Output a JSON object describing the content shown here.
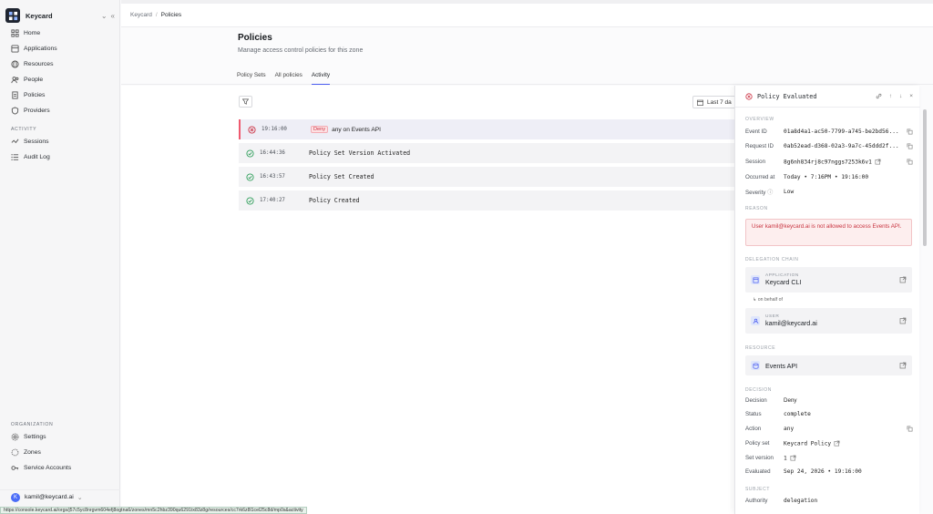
{
  "sidebar": {
    "brand": "Keycard",
    "nav": [
      {
        "label": "Home",
        "icon": "grid-icon"
      },
      {
        "label": "Applications",
        "icon": "apps-icon"
      },
      {
        "label": "Resources",
        "icon": "globe-icon"
      },
      {
        "label": "People",
        "icon": "people-icon"
      },
      {
        "label": "Policies",
        "icon": "document-icon"
      },
      {
        "label": "Providers",
        "icon": "shield-icon"
      }
    ],
    "activity_label": "ACTIVITY",
    "activity": [
      {
        "label": "Sessions",
        "icon": "sessions-icon"
      },
      {
        "label": "Audit Log",
        "icon": "list-icon"
      }
    ],
    "org_label": "ORGANIZATION",
    "org": [
      {
        "label": "Settings",
        "icon": "gear-icon"
      },
      {
        "label": "Zones",
        "icon": "zone-icon"
      },
      {
        "label": "Service Accounts",
        "icon": "key-icon"
      }
    ],
    "user": {
      "initial": "K",
      "email": "kamil@keycard.ai"
    }
  },
  "status_url": "https://console.keycard.ai/orgs/j57c5yc8nrgvm604efj8ogtna6/zones/mn5c2hbz390qu6291tx83z8g/resources/cc7rk6z8l1cel25c8d/mp0s&activity",
  "breadcrumb": [
    "Keycard",
    "Policies"
  ],
  "page": {
    "title": "Policies",
    "subtitle": "Manage access control policies for this zone",
    "tabs": [
      "Policy Sets",
      "All policies",
      "Activity"
    ],
    "active_tab": "Activity"
  },
  "filter": {
    "date_label": "Last 7 da"
  },
  "events": [
    {
      "time": "19:16:00",
      "status": "deny",
      "badge": "Deny",
      "text": "any on Events API",
      "edge": ""
    },
    {
      "time": "16:44:36",
      "status": "ok",
      "badge": "",
      "text": "Policy Set Version Activated",
      "edge": "J"
    },
    {
      "time": "16:43:57",
      "status": "ok",
      "badge": "",
      "text": "Policy Set Created",
      "edge": "J"
    },
    {
      "time": "17:40:27",
      "status": "ok",
      "badge": "",
      "text": "Policy Created",
      "edge": "J"
    }
  ],
  "panel": {
    "title": "Policy Evaluated",
    "overview_label": "OVERVIEW",
    "overview": [
      {
        "k": "Event ID",
        "v": "01a8d4a1-ac50-7799-a745-be2bd56...",
        "copy": true,
        "link": false
      },
      {
        "k": "Request ID",
        "v": "0ab52ead-d368-02a3-9a7c-45ddd2f...",
        "copy": true,
        "link": false
      },
      {
        "k": "Session",
        "v": "8g6nh834rj8c97nggs7253k6v1",
        "copy": true,
        "link": true
      },
      {
        "k": "Occurred at",
        "v": "Today • 7:16PM • 19:16:00",
        "copy": false,
        "link": false
      },
      {
        "k": "Severity",
        "v": "Low",
        "copy": false,
        "link": false
      }
    ],
    "reason_label": "REASON",
    "reason": "User kamil@keycard.ai is not allowed to access Events API.",
    "chain_label": "DELEGATION CHAIN",
    "application_label": "APPLICATION",
    "application": "Keycard CLI",
    "on_behalf": "on behalf of",
    "user_label": "USER",
    "user": "kamil@keycard.ai",
    "resource_label": "RESOURCE",
    "resource": "Events API",
    "decision_label": "DECISION",
    "decision": [
      {
        "k": "Decision",
        "v": "Deny"
      },
      {
        "k": "Status",
        "v": "complete"
      },
      {
        "k": "Action",
        "v": "any"
      },
      {
        "k": "Policy set",
        "v": "Keycard Policy"
      },
      {
        "k": "Set version",
        "v": "1"
      },
      {
        "k": "Evaluated",
        "v": "Sep 24, 2026 • 19:16:00"
      }
    ],
    "subject_label": "SUBJECT",
    "subject": [
      {
        "k": "Authority",
        "v": "delegation"
      }
    ]
  },
  "colors": {
    "accent": "#4a5cf0",
    "deny": "#cc3142",
    "ok": "#2f9e5a"
  }
}
